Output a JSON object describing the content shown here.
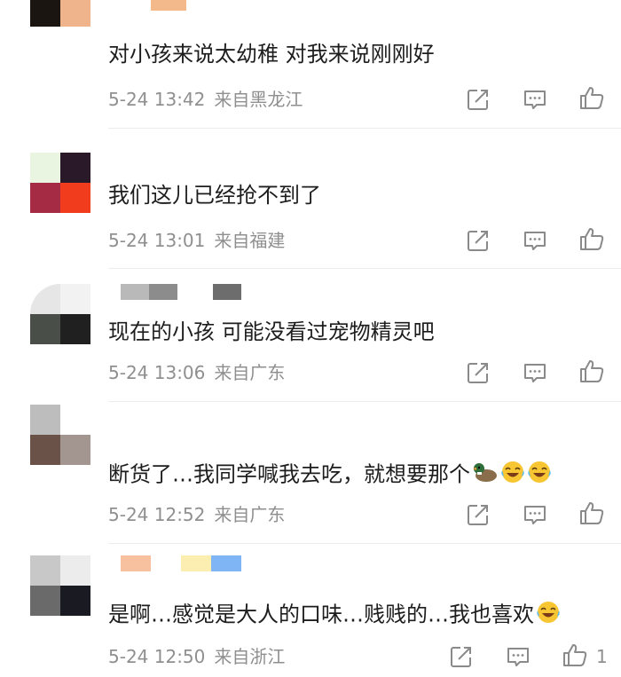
{
  "comments": [
    {
      "text": "对小孩来说太幼稚 对我来说刚刚好",
      "date": "5-24 13:42",
      "location": "来自黑龙江",
      "like_count": "",
      "avatar": [
        "#1b1512",
        "#f0b48d",
        "#ffffff",
        "#ffffff"
      ]
    },
    {
      "text": "我们这儿已经抢不到了",
      "date": "5-24 13:01",
      "location": "来自福建",
      "like_count": "",
      "avatar": [
        "#e9f4e1",
        "#2a1a29",
        "#a52a44",
        "#f23c1e"
      ]
    },
    {
      "text": "现在的小孩 可能没看过宠物精灵吧",
      "date": "5-24 13:06",
      "location": "来自广东",
      "like_count": "",
      "avatar": [
        "#e6e6e6",
        "#f2f2f2",
        "#4a4e48",
        "#202020"
      ]
    },
    {
      "text": "断货了…我同学喊我去吃，就想要那个",
      "emojis": [
        "duck-emoji",
        "laughing-tears-emoji",
        "laughing-tears-emoji"
      ],
      "date": "5-24 12:52",
      "location": "来自广东",
      "like_count": "",
      "avatar": [
        "#bdbdbd",
        "#6b5248",
        "#a3958f",
        "#3a2e2e"
      ]
    },
    {
      "text": "是啊…感觉是大人的口味…贱贱的…我也喜欢",
      "emojis": [
        "laughing-tears-emoji"
      ],
      "date": "5-24 12:50",
      "location": "来自浙江",
      "like_count": "1",
      "avatar": [
        "#c8c8c8",
        "#ececec",
        "#6a6a6a",
        "#1a1a22"
      ]
    }
  ],
  "icons": {
    "share": "share-icon",
    "reply": "comment-icon",
    "like": "thumbs-up-icon"
  },
  "colors": {
    "meta_text": "#8f8f8f",
    "icon_stroke": "#8a8a8a",
    "divider": "#ececec"
  }
}
